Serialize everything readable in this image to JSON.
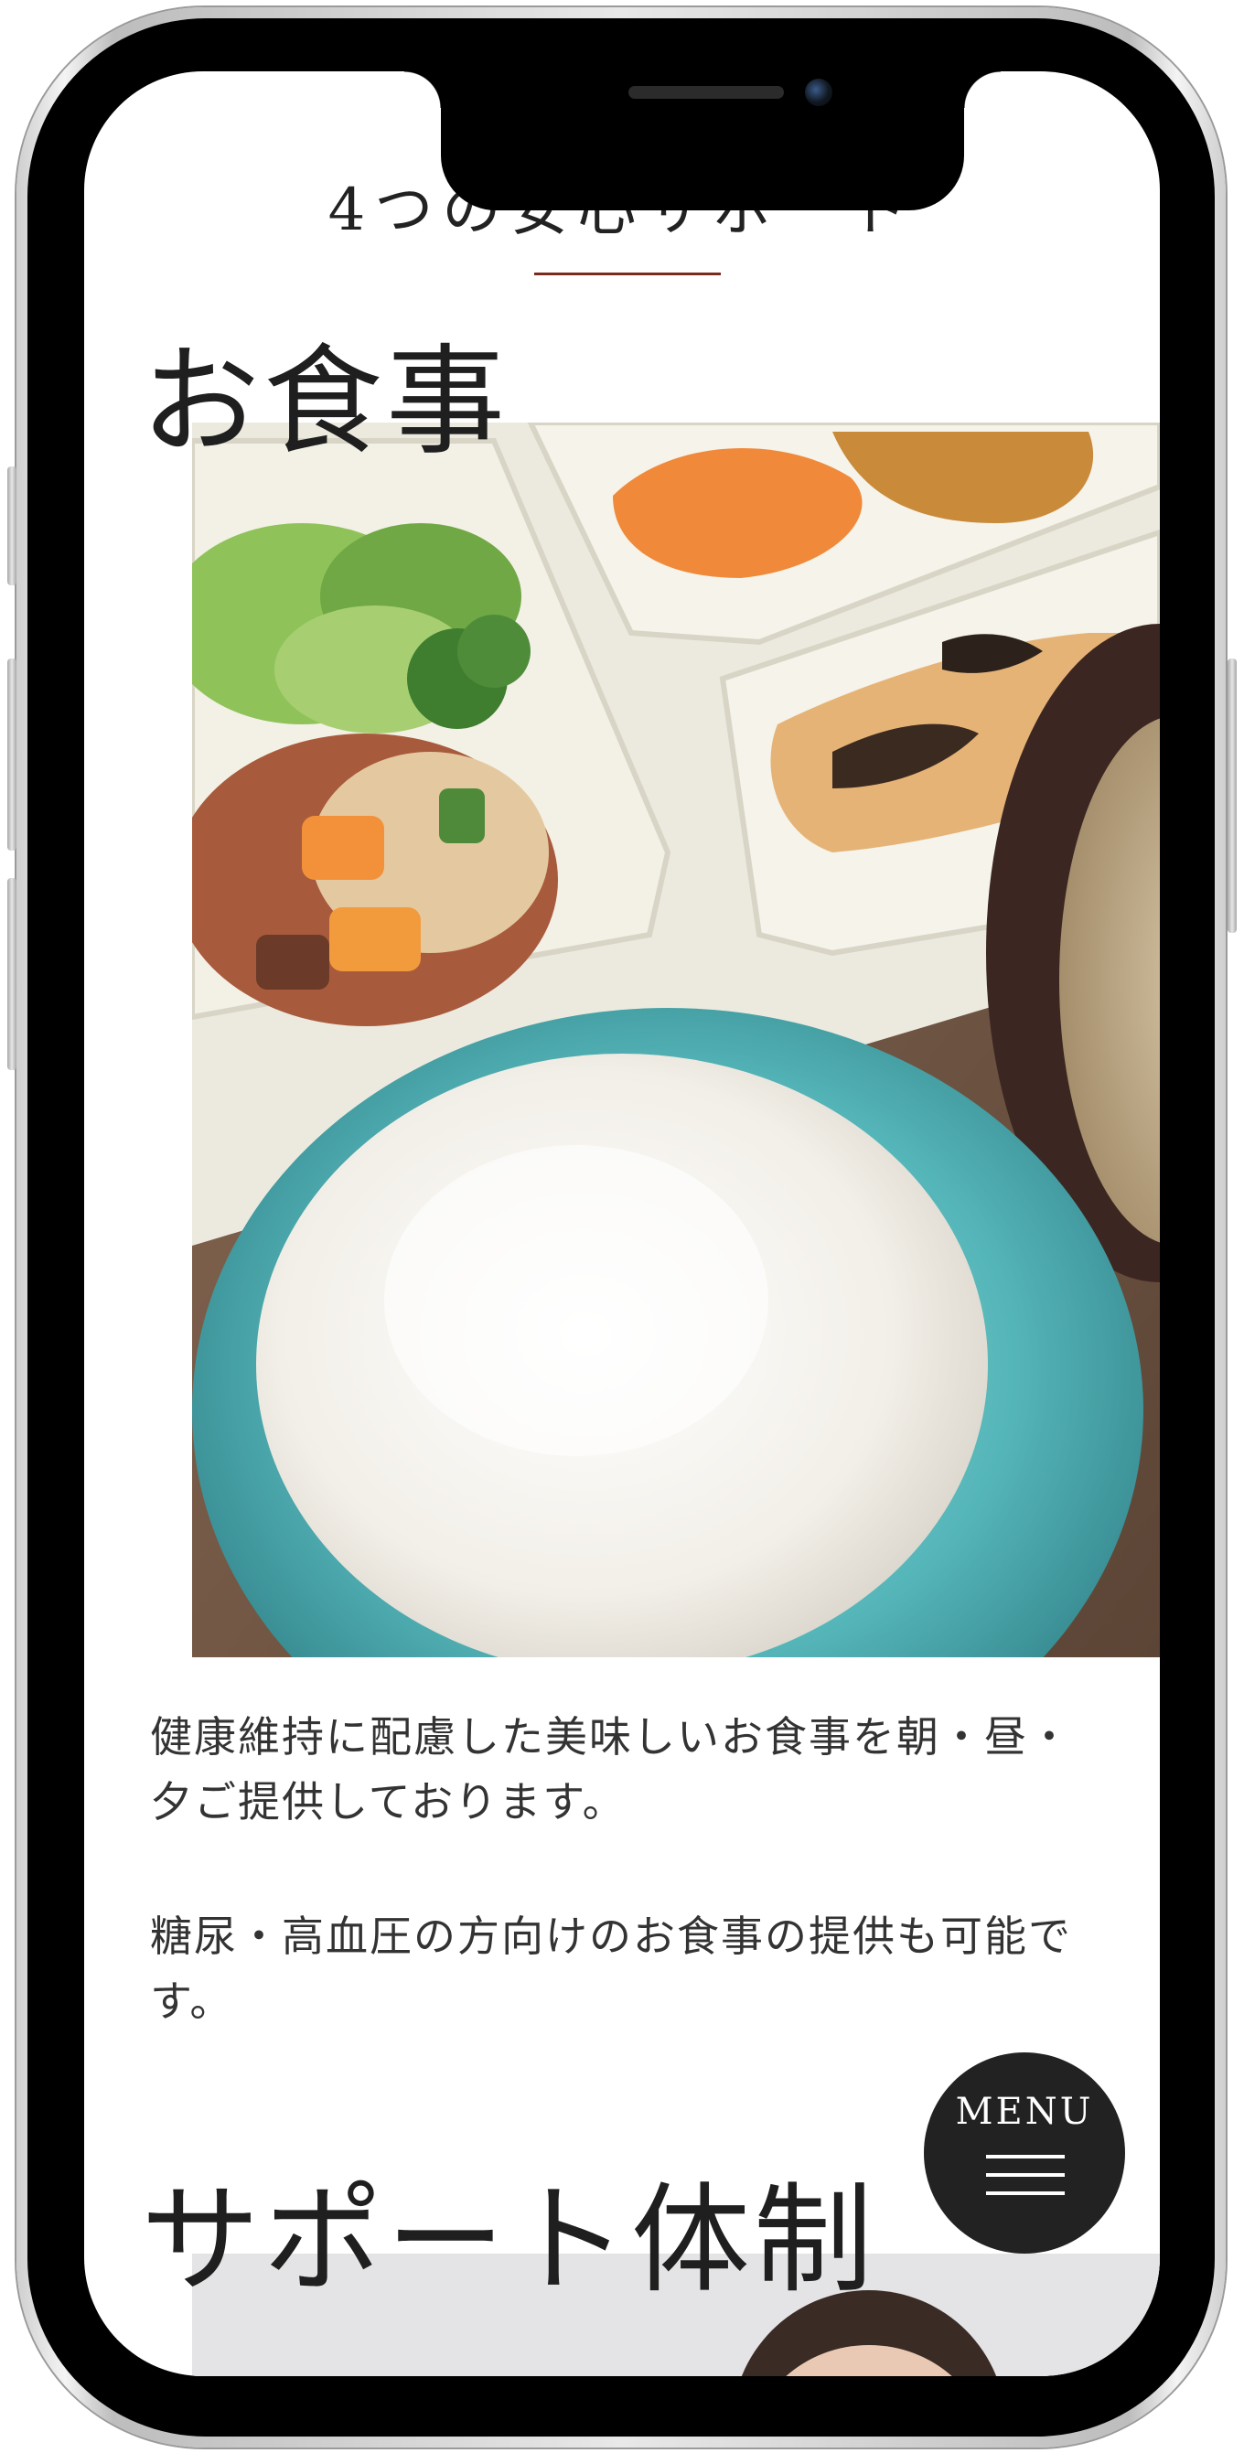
{
  "section": {
    "title": "4つの安心サポート"
  },
  "meals": {
    "heading": "お食事",
    "paragraph_1": "健康維持に配慮した美味しいお食事を朝・昼・夕ご提供しております。",
    "paragraph_2": "糖尿・高血圧の方向けのお食事の提供も可能です。"
  },
  "support": {
    "heading": "サポート体制"
  },
  "menu_button": {
    "label": "MENU",
    "icon": "hamburger-icon"
  },
  "colors": {
    "accent_underline": "#7a2a1e",
    "menu_button_bg": "#222222",
    "text": "#333333"
  }
}
